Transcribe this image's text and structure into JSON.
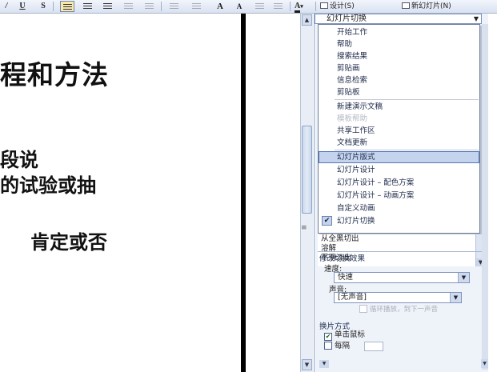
{
  "toolbar": {
    "underline_label": "U",
    "shadow_label": "S",
    "increase_font_label": "A",
    "decrease_font_label": "A",
    "font_color_label": "A",
    "design_label": "设计(S)",
    "new_slide_label": "新幻灯片(N)"
  },
  "slide": {
    "title": "程和方法",
    "line1": "段说",
    "line2": "的试验或抽",
    "line3": "肯定或否"
  },
  "task_pane": {
    "header": "幻灯片切换",
    "menu": [
      {
        "label": "开始工作",
        "state": "normal"
      },
      {
        "label": "帮助",
        "state": "normal"
      },
      {
        "label": "搜索结果",
        "state": "normal"
      },
      {
        "label": "剪贴画",
        "state": "normal"
      },
      {
        "label": "信息检索",
        "state": "normal"
      },
      {
        "label": "剪贴板",
        "state": "normal"
      },
      {
        "label": "新建演示文稿",
        "state": "normal"
      },
      {
        "label": "模板帮助",
        "state": "disabled"
      },
      {
        "label": "共享工作区",
        "state": "normal"
      },
      {
        "label": "文档更新",
        "state": "normal"
      },
      {
        "label": "幻灯片版式",
        "state": "highlighted"
      },
      {
        "label": "幻灯片设计",
        "state": "normal"
      },
      {
        "label": "幻灯片设计 – 配色方案",
        "state": "normal"
      },
      {
        "label": "幻灯片设计 – 动画方案",
        "state": "normal"
      },
      {
        "label": "自定义动画",
        "state": "normal"
      },
      {
        "label": "幻灯片切换",
        "state": "checked"
      }
    ],
    "transitions": [
      "从全黑切出",
      "溶解",
      "平滑淡出"
    ],
    "modify_section_title": "修改切换效果",
    "speed_label": "速度:",
    "speed_value": "快速",
    "sound_label": "声音:",
    "sound_value": "[无声音]",
    "loop_label": "循环播放，到下一声音",
    "advance_title": "换片方式",
    "on_click_label": "单击鼠标",
    "on_click_checked": true,
    "every_label": "每隔",
    "every_checked": false
  }
}
